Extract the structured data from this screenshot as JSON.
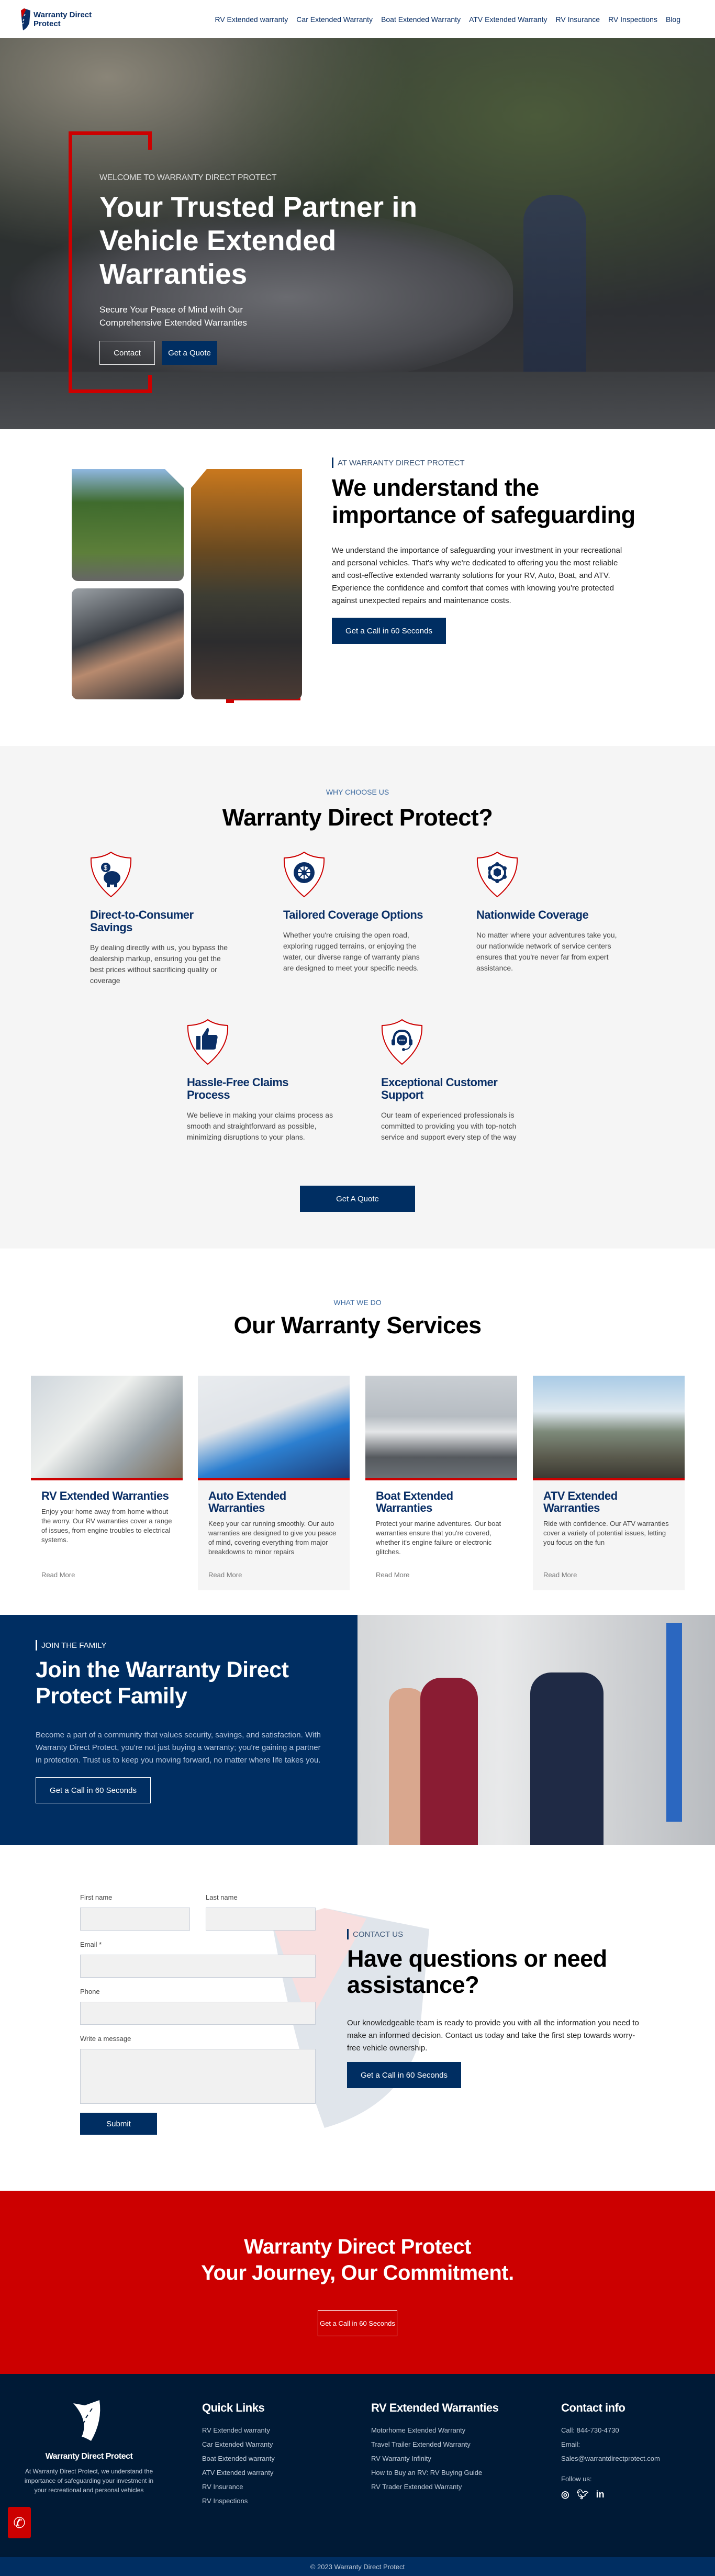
{
  "header": {
    "brand": "Warranty Direct Protect",
    "nav": [
      "RV Extended warranty",
      "Car Extended Warranty",
      "Boat Extended Warranty",
      "ATV Extended Warranty",
      "RV Insurance",
      "RV Inspections",
      "Blog"
    ]
  },
  "hero": {
    "eyebrow": "WELCOME TO WARRANTY DIRECT PROTECT",
    "title": "Your Trusted Partner in Vehicle Extended Warranties",
    "subtitle": "Secure Your Peace of Mind with Our Comprehensive Extended Warranties",
    "contact_label": "Contact",
    "quote_label": "Get a Quote"
  },
  "about": {
    "label": "AT WARRANTY DIRECT PROTECT",
    "title": "We understand the importance of safeguarding",
    "body": "We understand the importance of safeguarding your investment in your recreational and personal vehicles. That's why we're dedicated to offering you the most reliable and cost-effective extended warranty solutions for your RV, Auto, Boat, and ATV. Experience the confidence and comfort that comes with knowing you're protected against unexpected repairs and maintenance costs.",
    "cta": "Get a Call in 60 Seconds"
  },
  "why": {
    "label": "WHY CHOOSE US",
    "title": "Warranty Direct Protect?",
    "features": [
      {
        "icon": "piggy-bank",
        "title": "Direct-to-Consumer Savings",
        "body": "By dealing directly with us, you bypass the dealership markup, ensuring you get the best prices without sacrificing quality or coverage"
      },
      {
        "icon": "tire",
        "title": "Tailored Coverage Options",
        "body": "Whether you're cruising the open road, exploring rugged terrains, or enjoying the water, our diverse range of warranty plans are designed to meet your specific needs."
      },
      {
        "icon": "network",
        "title": "Nationwide Coverage",
        "body": "No matter where your adventures take you, our nationwide network of service centers ensures that you're never far from expert assistance."
      },
      {
        "icon": "thumbs-up",
        "title": "Hassle-Free Claims Process",
        "body": "We believe in making your claims process as smooth and straightforward as possible, minimizing disruptions to your plans."
      },
      {
        "icon": "headset",
        "title": "Exceptional Customer Support",
        "body": "Our team of experienced professionals is committed to providing you with top-notch service and support every step of the way"
      }
    ],
    "cta": "Get A Quote"
  },
  "services": {
    "label": "WHAT WE DO",
    "title": "Our Warranty Services",
    "cards": [
      {
        "title": "RV Extended Warranties",
        "body": "Enjoy your home away from home without the worry. Our RV warranties cover a range of issues, from engine troubles to electrical systems.",
        "link": "Read More"
      },
      {
        "title": "Auto Extended Warranties",
        "body": "Keep your car running smoothly. Our auto warranties are designed to give you peace of mind, covering everything from major breakdowns to minor repairs",
        "link": "Read More"
      },
      {
        "title": "Boat Extended Warranties",
        "body": "Protect your marine adventures. Our boat warranties ensure that you're covered, whether it's engine failure or electronic glitches.",
        "link": "Read More"
      },
      {
        "title": "ATV Extended Warranties",
        "body": "Ride with confidence. Our ATV warranties cover a variety of potential issues, letting you focus on the fun",
        "link": "Read More"
      }
    ]
  },
  "join": {
    "label": "JOIN THE FAMILY",
    "title": "Join the Warranty Direct Protect Family",
    "body": "Become a part of a community that values security, savings, and satisfaction. With Warranty Direct Protect, you're not just buying a warranty; you're gaining a partner in protection. Trust us to keep you moving forward, no matter where life takes you.",
    "cta": "Get a Call in 60 Seconds"
  },
  "contact": {
    "form": {
      "first_name_label": "First name",
      "last_name_label": "Last name",
      "email_label": "Email *",
      "phone_label": "Phone",
      "message_label": "Write a message",
      "submit": "Submit"
    },
    "label": "CONTACT US",
    "title": "Have questions or need assistance?",
    "body": "Our knowledgeable team is ready to provide you with all the information you need to make an informed decision. Contact us today and take the first step towards worry-free vehicle ownership.",
    "cta": "Get a Call in 60 Seconds"
  },
  "cta_band": {
    "line1": "Warranty Direct Protect",
    "line2": "Your Journey, Our Commitment.",
    "button": "Get a Call in 60 Seconds"
  },
  "footer": {
    "brand": "Warranty Direct Protect",
    "brand_text": "At Warranty Direct Protect, we understand the importance of safeguarding your investment in your recreational and personal vehicles",
    "quick_links_title": "Quick Links",
    "quick_links": [
      "RV Extended warranty",
      "Car Extended Warranty",
      "Boat Extended warranty",
      "ATV Extended warranty",
      "RV Insurance",
      "RV Inspections"
    ],
    "rv_title": "RV Extended Warranties",
    "rv_links": [
      "Motorhome Extended Warranty",
      "Travel Trailer Extended Warranty",
      "RV Warranty Infinity",
      "How to Buy an RV: RV Buying Guide",
      "RV Trader Extended Warranty"
    ],
    "contact_title": "Contact info",
    "call": "Call: 844-730-4730",
    "email_label": "Email:",
    "email": "Sales@warrantdirectprotect.com",
    "follow": "Follow us:",
    "social": [
      "instagram",
      "twitter",
      "linkedin"
    ],
    "copyright": "© 2023 Warranty Direct Protect"
  },
  "colors": {
    "navy": "#002e62",
    "red": "#cc0000",
    "footer_bg": "#001a36",
    "light_bg": "#f5f5f5"
  }
}
